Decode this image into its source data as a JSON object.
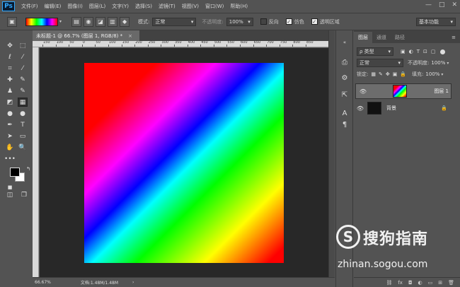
{
  "app": {
    "logo": "Ps"
  },
  "menu": [
    "文件(F)",
    "编辑(E)",
    "图像(I)",
    "图层(L)",
    "文字(Y)",
    "选择(S)",
    "滤镜(T)",
    "视图(V)",
    "窗口(W)",
    "帮助(H)"
  ],
  "window_controls": {
    "minimize": "—",
    "maximize": "□",
    "close": "✕"
  },
  "options": {
    "gradient_colors": [
      "#ff0000",
      "#ffff00",
      "#00ff00",
      "#00ffff",
      "#0000ff",
      "#ff00ff",
      "#ff0000"
    ],
    "mode_label": "模式:",
    "mode_value": "正常",
    "opacity_label": "不透明度:",
    "opacity_value": "100%",
    "reverse_label": "反向",
    "reverse_checked": false,
    "dither_label": "仿色",
    "dither_checked": true,
    "transparency_label": "透明区域",
    "transparency_checked": true,
    "workspace": "基本功能"
  },
  "document": {
    "tab_title": "未标题-1 @ 66.7% (图层 1, RGB/8) *",
    "close": "×"
  },
  "ruler": {
    "top_ticks": [
      "150",
      "100",
      "50",
      "0",
      "50",
      "100",
      "150",
      "200",
      "250",
      "300",
      "350",
      "400",
      "450",
      "500",
      "550",
      "600",
      "650",
      "700",
      "750",
      "800",
      "850"
    ]
  },
  "status": {
    "zoom": "66.67%",
    "doc_info": "文档:1.48M/1.48M"
  },
  "layers_panel": {
    "tabs": [
      "图层",
      "通道",
      "路径"
    ],
    "filter_label": "ρ 类型",
    "blend_mode": "正常",
    "opacity_label": "不透明度:",
    "opacity_value": "100%",
    "lock_label": "锁定:",
    "fill_label": "填充:",
    "fill_value": "100%",
    "layers": [
      {
        "name": "图层 1",
        "selected": true
      },
      {
        "name": "背景",
        "selected": false,
        "locked": true
      }
    ],
    "footer_icons": [
      "link-icon",
      "fx-icon",
      "mask-icon",
      "adjustment-icon",
      "folder-icon",
      "new-layer-icon",
      "trash-icon"
    ],
    "footer_glyphs": [
      "⛓",
      "fx",
      "◘",
      "◐",
      "▭",
      "⊞",
      "🗑"
    ]
  },
  "watermark": {
    "logo_letter": "S",
    "text": "搜狗指南",
    "url": "zhinan.sogou.com"
  }
}
